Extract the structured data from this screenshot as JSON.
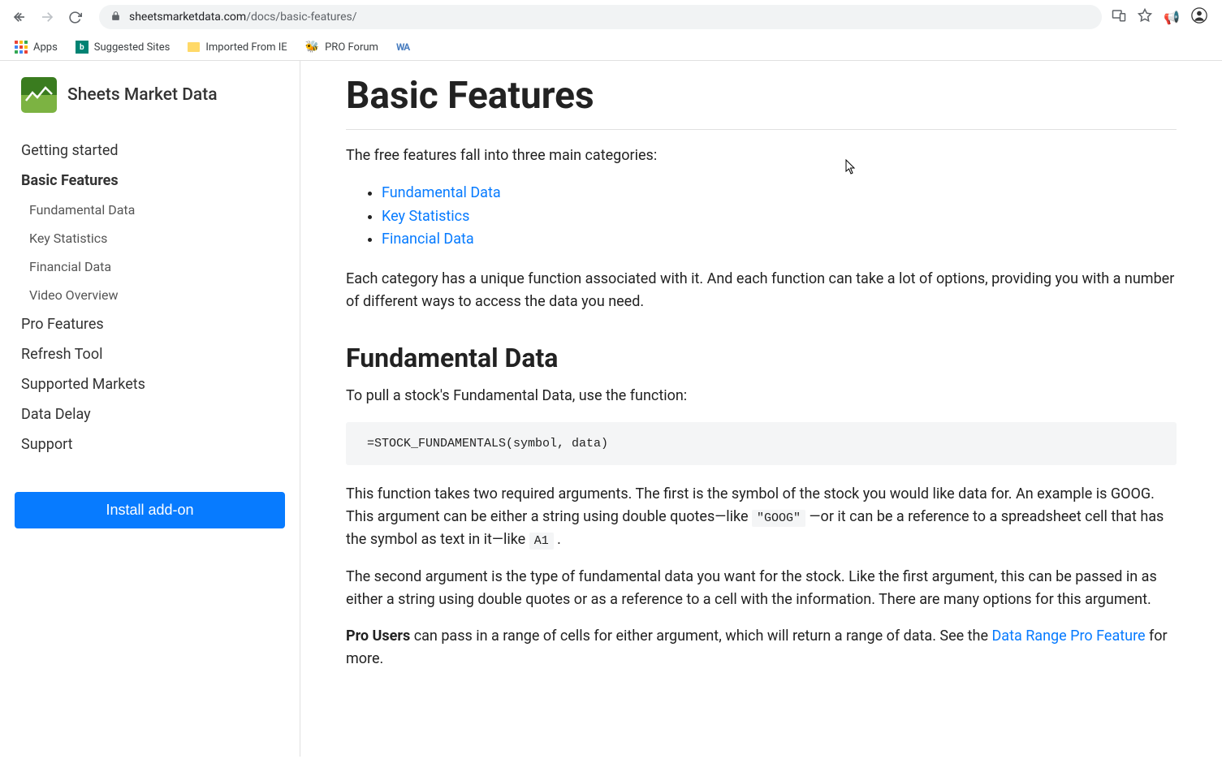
{
  "browser": {
    "url_host": "sheetsmarketdata.com",
    "url_path": "/docs/basic-features/",
    "bookmarks": {
      "apps": "Apps",
      "suggested": "Suggested Sites",
      "imported": "Imported From IE",
      "pro_forum": "PRO Forum"
    }
  },
  "sidebar": {
    "site_title": "Sheets Market Data",
    "items": [
      "Getting started",
      "Basic Features",
      "Pro Features",
      "Refresh Tool",
      "Supported Markets",
      "Data Delay",
      "Support"
    ],
    "sub_items": [
      "Fundamental Data",
      "Key Statistics",
      "Financial Data",
      "Video Overview"
    ],
    "install_label": "Install add-on"
  },
  "content": {
    "title": "Basic Features",
    "intro": "The free features fall into three main categories:",
    "links": [
      "Fundamental Data",
      "Key Statistics",
      "Financial Data"
    ],
    "para2": "Each category has a unique function associated with it. And each function can take a lot of options, providing you with a number of different ways to access the data you need.",
    "section1_title": "Fundamental Data",
    "section1_intro": "To pull a stock's Fundamental Data, use the function:",
    "code1": "=STOCK_FUNDAMENTALS(symbol, data)",
    "para3_a": "This function takes two required arguments. The first is the symbol of the stock you would like data for. An example is GOOG. This argument can be either a string using double quotes—like ",
    "code_goog": "\"GOOG\"",
    "para3_b": " —or it can be a reference to a spreadsheet cell that has the symbol as text in it—like ",
    "code_a1": "A1",
    "para3_c": " .",
    "para4": "The second argument is the type of fundamental data you want for the stock. Like the first argument, this can be passed in as either a string using double quotes or as a reference to a cell with the information. There are many options for this argument.",
    "para5_bold": "Pro Users",
    "para5_a": " can pass in a range of cells for either argument, which will return a range of data. See the ",
    "para5_link": "Data Range Pro Feature",
    "para5_b": " for more."
  }
}
